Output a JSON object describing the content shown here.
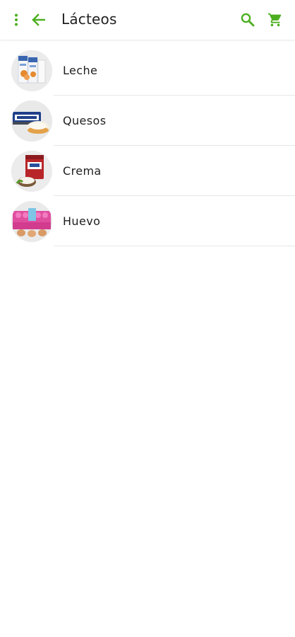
{
  "toolbar": {
    "title": "Lácteos",
    "menu_icon": "more-vert-icon",
    "back_icon": "arrow-back-icon",
    "search_icon": "search-icon",
    "cart_icon": "shopping-cart-icon",
    "accent_color": "#4caf1f"
  },
  "categories": [
    {
      "label": "Leche",
      "thumbnail": "milk-cartons-image"
    },
    {
      "label": "Quesos",
      "thumbnail": "cream-cheese-image"
    },
    {
      "label": "Crema",
      "thumbnail": "cream-tub-image"
    },
    {
      "label": "Huevo",
      "thumbnail": "egg-carton-image"
    }
  ]
}
